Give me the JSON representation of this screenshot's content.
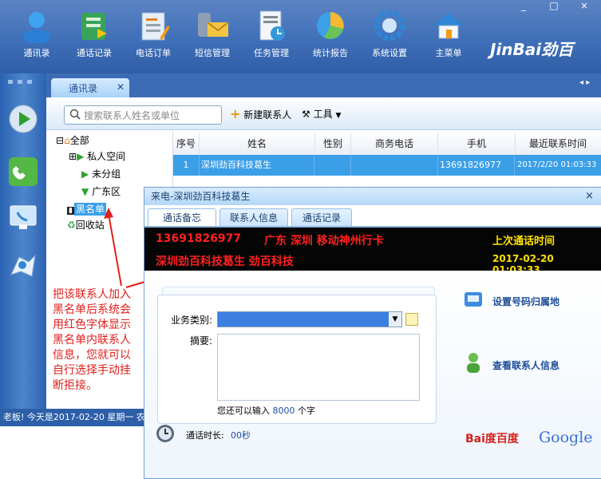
{
  "window": {
    "controls": [
      "_",
      "□",
      "×"
    ]
  },
  "toolbar": {
    "items": [
      {
        "label": "通讯录",
        "icon": "contacts-icon"
      },
      {
        "label": "通话记录",
        "icon": "call-records-icon"
      },
      {
        "label": "电话订单",
        "icon": "phone-order-icon"
      },
      {
        "label": "短信管理",
        "icon": "sms-icon"
      },
      {
        "label": "任务管理",
        "icon": "task-icon"
      },
      {
        "label": "统计报告",
        "icon": "report-icon"
      },
      {
        "label": "系统设置",
        "icon": "settings-icon"
      },
      {
        "label": "主菜单",
        "icon": "home-icon"
      }
    ],
    "logo_text": "JinBai劲百"
  },
  "tabs": {
    "active_label": "通讯录",
    "close": "✕",
    "nav": "◂ ▸"
  },
  "contacts_toolbar": {
    "search_placeholder": "搜索联系人姓名或单位",
    "new_contact": "新建联系人",
    "tools": "工具"
  },
  "tree": {
    "nodes": [
      {
        "label": "全部"
      },
      {
        "label": "私人空间"
      },
      {
        "label": "未分组"
      },
      {
        "label": "广东区"
      },
      {
        "label": "黑名单"
      },
      {
        "label": "回收站"
      }
    ]
  },
  "table": {
    "columns": [
      "序号",
      "姓名",
      "性别",
      "商务电话",
      "手机",
      "最近联系时间"
    ],
    "rows": [
      {
        "no": "1",
        "name": "深圳劲百科技葛生",
        "gender": "",
        "work_phone": "",
        "mobile": "13691826977",
        "last_contact": "2017/2/20 01:03:33"
      }
    ]
  },
  "status_bar": {
    "text": "老板! 今天是2017-02-20 星期一 农"
  },
  "popup": {
    "title": "来电-深圳劲百科技葛生",
    "close": "×",
    "tabs": [
      "通话备忘",
      "联系人信息",
      "通话记录"
    ],
    "led": {
      "number": "13691826977",
      "location": "广东  深圳  移动神州行卡",
      "last_call_label": "上次通话时间",
      "contact": "深圳劲百科技葛生    劲百科技",
      "last_call_time": "2017-02-20 01:03:33"
    },
    "form": {
      "category_label": "业务类别:",
      "summary_label": "摘要:",
      "remaining_prefix": "您还可以输入",
      "remaining_count": "8000",
      "remaining_suffix": "个字"
    },
    "duration_label": "通话时长:",
    "duration_value": "00秒",
    "links": {
      "set_area": "设置号码归属地",
      "view_contact": "查看联系人信息"
    },
    "search_logos": {
      "baidu": "Bai度百度",
      "google": "Google"
    }
  },
  "annotation": {
    "text": "把该联系人加入黑名单后系统会用红色字体显示黑名单内联系人信息，您就可以自行选择手动挂断拒接。"
  },
  "colors": {
    "topbar": "#3f6fb8",
    "selected_row": "#3b9fe8",
    "led_red": "#ff2020",
    "led_yellow": "#ffe100",
    "annotation": "#e0201c"
  }
}
